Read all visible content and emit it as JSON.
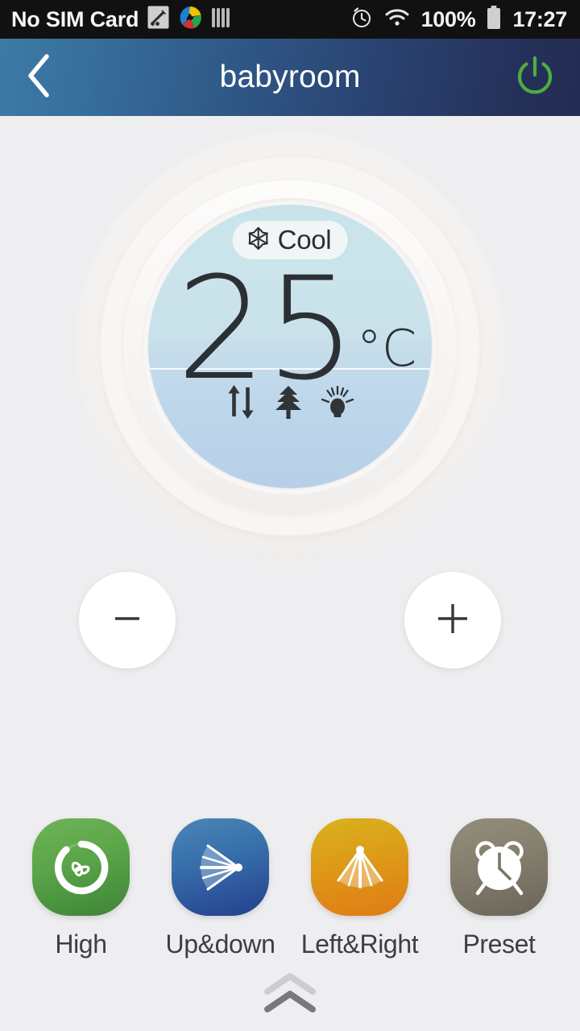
{
  "status_bar": {
    "carrier_text": "No SIM Card",
    "battery_percent": "100%",
    "clock": "17:27",
    "icons": [
      "screenshot-capture-icon",
      "app-logo-icon",
      "signal-bars-icon",
      "alarm-clock-icon",
      "wifi-icon",
      "battery-icon"
    ]
  },
  "header": {
    "title": "babyroom",
    "back_icon": "chevron-left-icon",
    "power_icon": "power-icon",
    "power_color": "#4caf3f",
    "gradient_from": "#3d7ba6",
    "gradient_to": "#232c52"
  },
  "dial": {
    "mode_label": "Cool",
    "mode_icon": "snowflake-icon",
    "temperature": "25",
    "unit": "°C",
    "face_color_top": "#c8e4ea",
    "face_color_bottom": "#b6d0e8",
    "status_icons": [
      "up-down-arrows-icon",
      "tree-icon",
      "light-bulb-icon"
    ]
  },
  "controls": {
    "minus_label": "−",
    "plus_label": "+",
    "minus_icon": "minus-icon",
    "plus_icon": "plus-icon"
  },
  "functions": [
    {
      "label": "High",
      "icon": "fan-speed-icon",
      "color_from": "#63ab4c",
      "color_to": "#3d8436"
    },
    {
      "label": "Up&down",
      "icon": "vertical-swing-icon",
      "color_from": "#3a7eb0",
      "color_to": "#243f8f"
    },
    {
      "label": "Left&Right",
      "icon": "horizontal-swing-icon",
      "color_from": "#d6ae1e",
      "color_to": "#e07b15"
    },
    {
      "label": "Preset",
      "icon": "alarm-clock-icon",
      "color_from": "#8a8573",
      "color_to": "#6d675a"
    }
  ],
  "expand_handle": {
    "icon": "double-chevron-up-icon"
  }
}
